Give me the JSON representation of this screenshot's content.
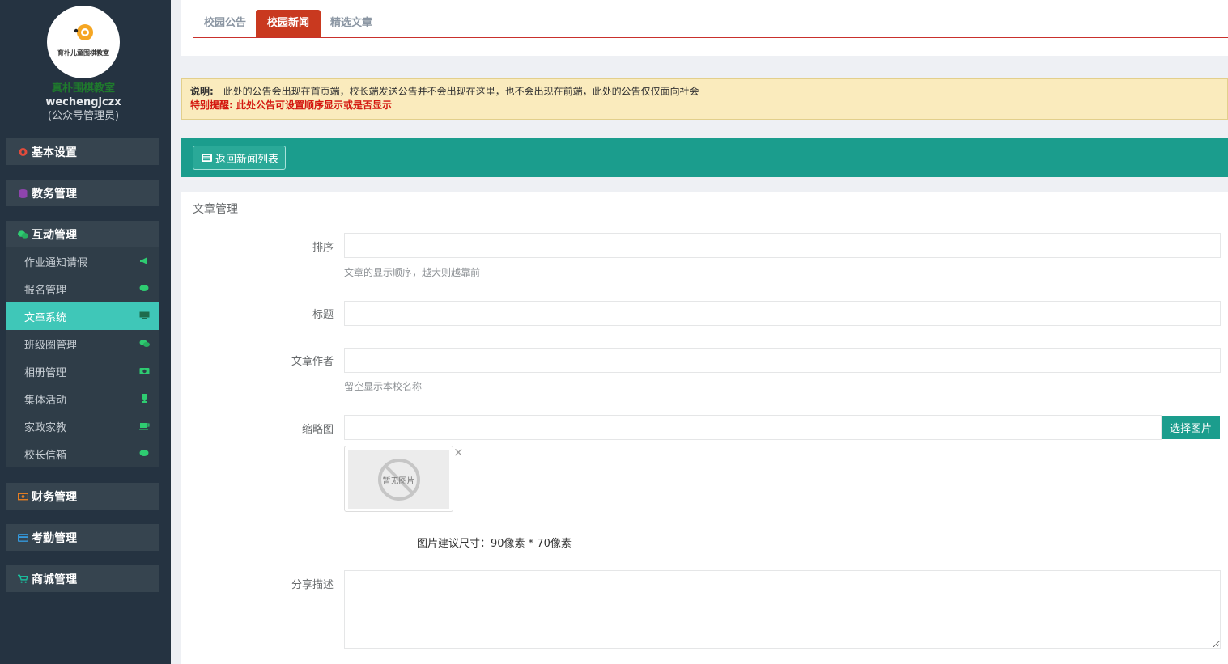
{
  "sidebar": {
    "logo_text": "育朴儿童围棋教室",
    "school_name": "真朴围棋教室",
    "user_name": "wechengjczx",
    "user_role": "(公众号管理员)",
    "menus": [
      {
        "label": "基本设置",
        "icon": "gear-icon"
      },
      {
        "label": "教务管理",
        "icon": "database-icon"
      },
      {
        "label": "互动管理",
        "icon": "wechat-icon"
      },
      {
        "label": "财务管理",
        "icon": "money-icon"
      },
      {
        "label": "考勤管理",
        "icon": "credit-card-icon"
      },
      {
        "label": "商城管理",
        "icon": "cart-icon"
      }
    ],
    "sub_items": [
      {
        "label": "作业通知请假",
        "icon": "bullhorn-icon"
      },
      {
        "label": "报名管理",
        "icon": "comments-icon"
      },
      {
        "label": "文章系统",
        "icon": "desktop-icon"
      },
      {
        "label": "班级圈管理",
        "icon": "wechat-icon"
      },
      {
        "label": "相册管理",
        "icon": "camera-icon"
      },
      {
        "label": "集体活动",
        "icon": "trophy-icon"
      },
      {
        "label": "家政家教",
        "icon": "coffee-icon"
      },
      {
        "label": "校长信箱",
        "icon": "comments-icon"
      }
    ],
    "active_sub": "文章系统"
  },
  "tabs": [
    {
      "label": "校园公告"
    },
    {
      "label": "校园新闻"
    },
    {
      "label": "精选文章"
    }
  ],
  "active_tab": "校园新闻",
  "notice": {
    "prefix": "说明:",
    "text": "此处的公告会出现在首页端，校长端发送公告并不会出现在这里，也不会出现在前端，此处的公告仅仅面向社会",
    "warning": "特别提醒: 此处公告可设置顺序显示或是否显示"
  },
  "back_button": "返回新闻列表",
  "form": {
    "title": "文章管理",
    "sort_label": "排序",
    "sort_value": "",
    "sort_help": "文章的显示顺序，越大则越靠前",
    "title_label": "标题",
    "title_value": "",
    "author_label": "文章作者",
    "author_value": "",
    "author_help": "留空显示本校名称",
    "thumb_label": "缩略图",
    "thumb_value": "",
    "pick_button": "选择图片",
    "no_image": "暂无图片",
    "close_mark": "×",
    "size_tip": "图片建议尺寸：90像素 * 70像素",
    "share_label": "分享描述",
    "share_value": ""
  },
  "colors": {
    "sidebar_bg": "#253341",
    "active_sub_bg": "#3fc7b8",
    "tab_active": "#c9391f",
    "green_bar": "#1b9d8d",
    "notice_bg": "#faebbd"
  }
}
